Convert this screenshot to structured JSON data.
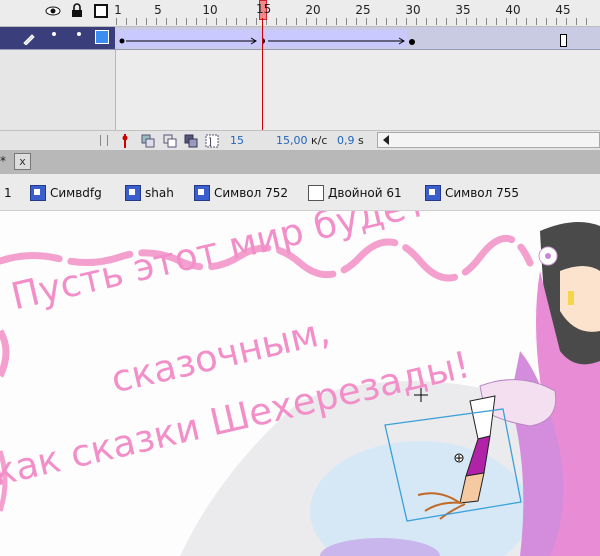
{
  "timeline": {
    "ruler_numbers": [
      "1",
      "5",
      "10",
      "15",
      "20",
      "25",
      "30",
      "35",
      "40",
      "45"
    ],
    "current_frame": "15",
    "fps": "15,00",
    "fps_unit": "к/с",
    "elapsed": "0,9",
    "elapsed_unit": "s"
  },
  "tab": {
    "close": "x",
    "number": "1"
  },
  "breadcrumb": [
    {
      "label": "Симвdfg",
      "icon": "symbol-icon"
    },
    {
      "label": "shah",
      "icon": "symbol-icon"
    },
    {
      "label": "Символ 752",
      "icon": "symbol-icon"
    },
    {
      "label": "Двойной 61",
      "icon": "graphic-icon"
    },
    {
      "label": "Символ 755",
      "icon": "symbol-icon"
    }
  ],
  "stage": {
    "line1": "Пусть этот мир будет",
    "line2": "сказочным,",
    "line3": "как сказки Шехерезады!"
  },
  "colors": {
    "text_pink": "#f28ec8",
    "tween_fill": "#c9c9ff",
    "playhead": "#cc0000"
  }
}
